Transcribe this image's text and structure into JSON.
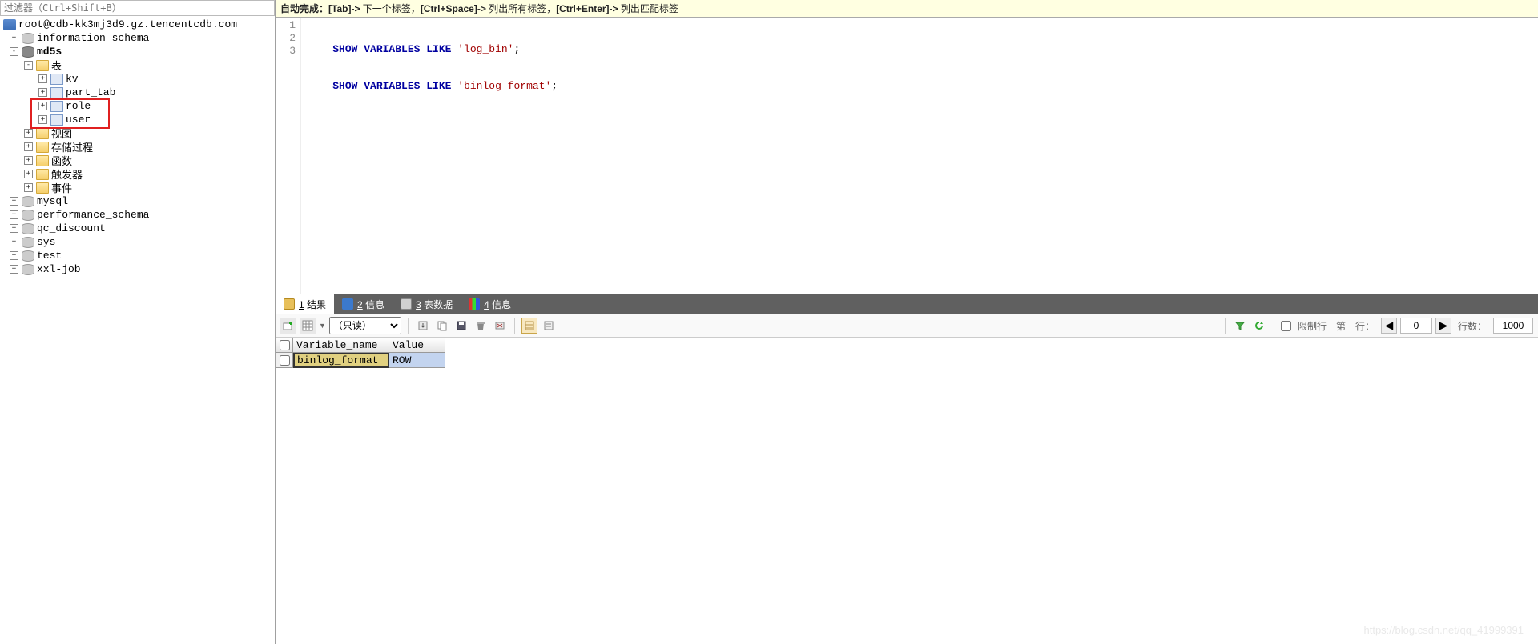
{
  "filter_placeholder": "过滤器（Ctrl+Shift+B）",
  "tree": {
    "server": "root@cdb-kk3mj3d9.gz.tencentcdb.com",
    "db_info_schema": "information_schema",
    "db_active": "md5s",
    "folder_tables": "表",
    "t_kv": "kv",
    "t_part_tab": "part_tab",
    "t_role": "role",
    "t_user": "user",
    "folder_views": "视图",
    "folder_procs": "存储过程",
    "folder_funcs": "函数",
    "folder_triggers": "触发器",
    "folder_events": "事件",
    "db_mysql": "mysql",
    "db_perf": "performance_schema",
    "db_qc": "qc_discount",
    "db_sys": "sys",
    "db_test": "test",
    "db_xxl": "xxl-job"
  },
  "hint": {
    "prefix": "自动完成：",
    "k1": "[Tab]->",
    "t1": " 下一个标签，",
    "k2": "[Ctrl+Space]->",
    "t2": " 列出所有标签，",
    "k3": "[Ctrl+Enter]->",
    "t3": " 列出匹配标签"
  },
  "sql": {
    "kw1": "SHOW VARIABLES LIKE",
    "str1": "'log_bin'",
    "kw2": "SHOW VARIABLES LIKE",
    "str2": "'binlog_format'"
  },
  "gutter": [
    "1",
    "2",
    "3"
  ],
  "tabs": {
    "result": {
      "num": "1",
      "label": "结果"
    },
    "info1": {
      "num": "2",
      "label": "信息"
    },
    "tdata": {
      "num": "3",
      "label": "表数据"
    },
    "info2": {
      "num": "4",
      "label": "信息"
    }
  },
  "toolbar": {
    "mode": "（只读）",
    "limit_label": "限制行",
    "first_row": "第一行：",
    "first_row_value": "0",
    "rows_label": "行数：",
    "rows_value": "1000"
  },
  "grid": {
    "h_name": "Variable_name",
    "h_value": "Value",
    "r1_name": "binlog_format",
    "r1_value": "ROW"
  },
  "watermark": "https://blog.csdn.net/qq_41999391"
}
